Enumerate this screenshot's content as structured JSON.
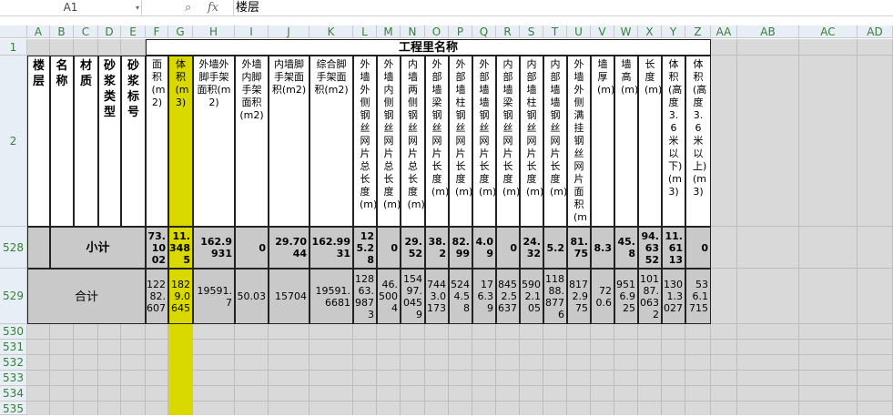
{
  "formula_bar": {
    "name_box": "A1",
    "fx_label": "fx",
    "content": "楼层"
  },
  "columns": [
    "A",
    "B",
    "C",
    "D",
    "E",
    "F",
    "G",
    "H",
    "I",
    "J",
    "K",
    "L",
    "M",
    "N",
    "O",
    "P",
    "Q",
    "R",
    "S",
    "T",
    "U",
    "V",
    "W",
    "X",
    "Y",
    "Z",
    "AA",
    "AB",
    "AC",
    "AD"
  ],
  "rows": {
    "r1": "1",
    "r2": "2",
    "r528": "528",
    "r529": "529",
    "r530": "530",
    "r531": "531",
    "r532": "532",
    "r533": "533",
    "r534": "534",
    "r535": "535"
  },
  "sheet": {
    "merged_title": "工程里名称",
    "left_headers": [
      "楼层",
      "名称",
      "材质",
      "砂浆类型",
      "砂浆标号"
    ],
    "headers": [
      "面积(m2)",
      "体积(m3)",
      "外墙外脚手架面积(m2)",
      "外墙内脚手架面积(m2)",
      "内墙脚手架面积(m2)",
      "综合脚手架面积(m2)",
      "外墙外侧钢丝网片总长度(m)",
      "外墙内侧钢丝网片总长度(m)",
      "内墙两侧钢丝网片总长度(m)",
      "外部墙梁钢丝网片长度(m)",
      "外部墙柱钢丝网片长度(m)",
      "外部墙墙钢丝网片长度(m)",
      "内部墙梁钢丝网片长度(m)",
      "内部墙柱钢丝网片长度(m)",
      "内部墙墙钢丝网片长度(m)",
      "外墙外侧满挂钢丝网片面积(m2)",
      "墙厚(m)",
      "墙高(m)",
      "长度(m)",
      "体积(高度3.6米以下)(m3)",
      "体积(高度3.6米以上)(m3)"
    ],
    "subtotal_label": "小计",
    "subtotal_values": [
      "73.1002",
      "11.3485",
      "162.9931",
      "0",
      "29.7044",
      "162.9931",
      "125.28",
      "0",
      "29.52",
      "38.2",
      "82.99",
      "4.09",
      "0",
      "24.32",
      "5.2",
      "81.75",
      "8.3",
      "45.8",
      "94.6352",
      "11.6113",
      "0"
    ],
    "total_label": "合计",
    "total_values": [
      "12282.607",
      "1829.0645",
      "19591.7",
      "50.03",
      "15704",
      "19591.6681",
      "12863.9873",
      "46.5004",
      "15497.0459",
      "7443.0173",
      "5244.58",
      "176.39",
      "8452.5637",
      "5902.105",
      "11888.8776",
      "8172.975",
      "720.6",
      "9516.925",
      "10187.0632",
      "1301.3027",
      "536.1715"
    ]
  }
}
